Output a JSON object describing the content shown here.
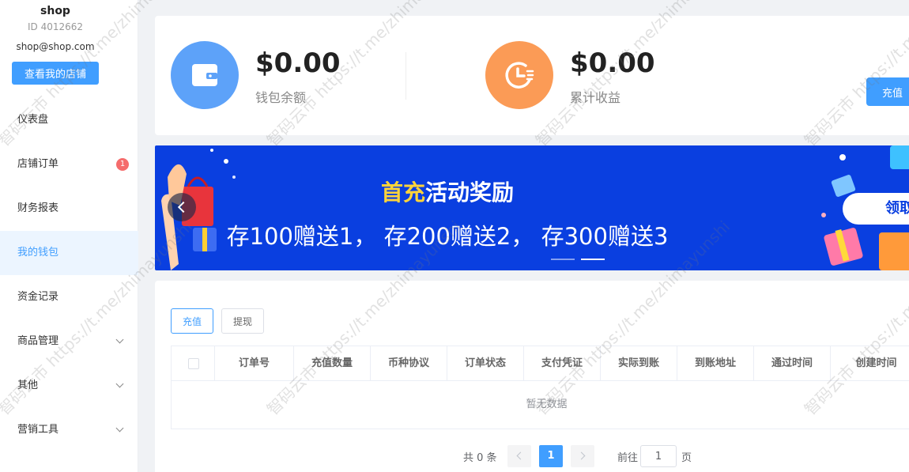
{
  "sidebar": {
    "shop_name": "shop",
    "shop_id": "ID 4012662",
    "email": "shop@shop.com",
    "view_store_label": "查看我的店铺",
    "items": [
      {
        "label": "仪表盘",
        "active": false
      },
      {
        "label": "店铺订单",
        "badge": "1",
        "active": false
      },
      {
        "label": "财务报表",
        "active": false
      },
      {
        "label": "我的钱包",
        "active": true
      },
      {
        "label": "资金记录",
        "active": false
      },
      {
        "label": "商品管理",
        "expandable": true
      },
      {
        "label": "其他",
        "expandable": true
      },
      {
        "label": "营销工具",
        "expandable": true
      }
    ]
  },
  "wallet": {
    "balance_amount": "$0.00",
    "balance_label": "钱包余额",
    "earnings_amount": "$0.00",
    "earnings_label": "累计收益",
    "recharge_label": "充值",
    "colors": {
      "balance_icon": "#5da2f9",
      "earnings_icon": "#fb9b56",
      "accent": "#409eff"
    },
    "icons": [
      "wallet-icon",
      "earnings-clock-icon"
    ]
  },
  "banner": {
    "title_highlight": "首充",
    "title_rest": "活动奖励",
    "subtitle": "存100赠送1， 存200赠送2， 存300赠送3",
    "claim_label": "领取",
    "background": "#0a3fe0"
  },
  "records": {
    "tabs": {
      "recharge": "充值",
      "withdraw": "提现"
    },
    "columns": [
      "订单号",
      "充值数量",
      "币种协议",
      "订单状态",
      "支付凭证",
      "实际到账",
      "到账地址",
      "通过时间",
      "创建时间"
    ],
    "empty_text": "暂无数据",
    "pagination": {
      "total_text": "共 0 条",
      "current_page": "1",
      "goto_label": "前往",
      "goto_value": "1",
      "goto_suffix": "页"
    }
  },
  "watermark": {
    "text": "智码云市 https://t.me/zhimayunshi"
  }
}
